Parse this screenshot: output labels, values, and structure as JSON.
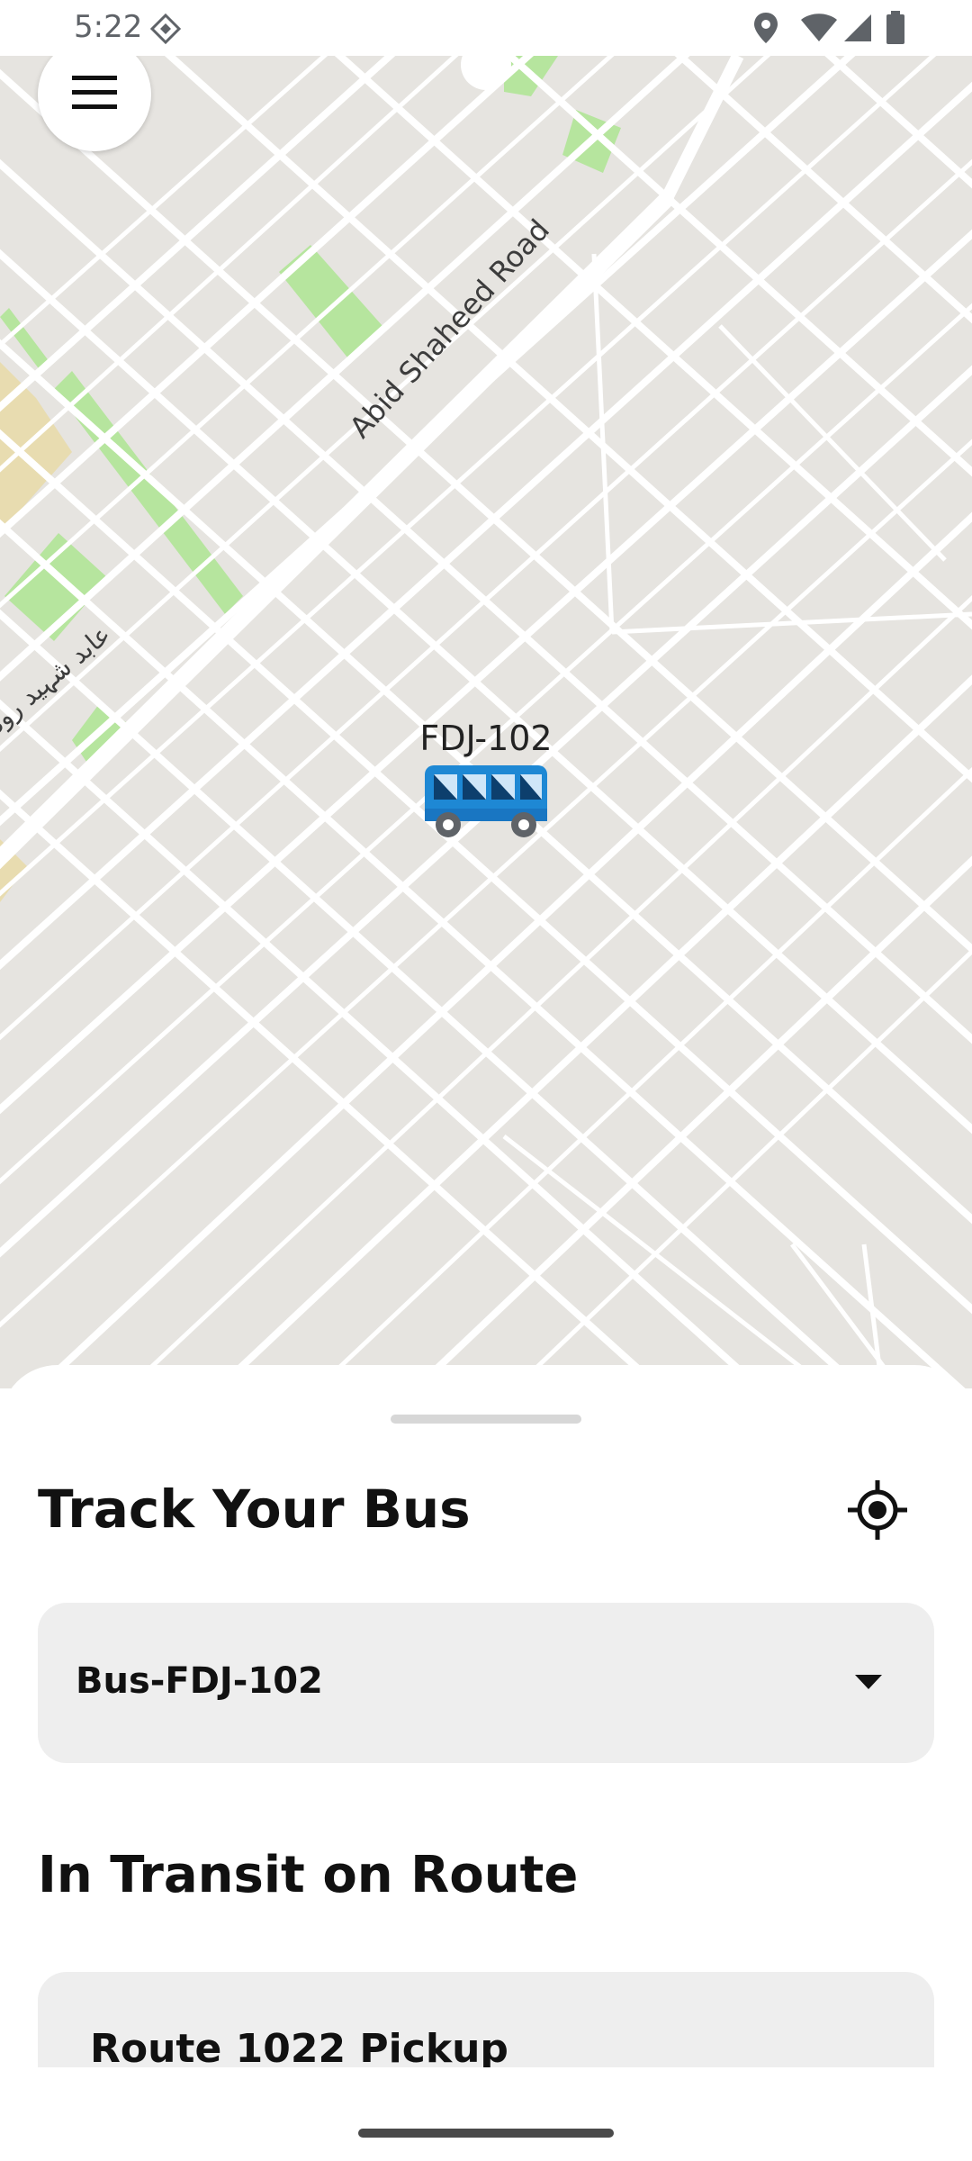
{
  "status_bar": {
    "time": "5:22",
    "icons": [
      "diamond-notification-icon",
      "location-icon",
      "wifi-icon",
      "signal-icon",
      "battery-icon"
    ]
  },
  "map": {
    "road_label": "Abid Shaheed Road",
    "urdu_road_label": "عابد شہید روڈ",
    "bus_marker_label": "FDJ-102",
    "colors": {
      "background": "#e6e4e0",
      "roads": "#ffffff",
      "parks": "#b6e59e",
      "sand": "#e8dcb0"
    }
  },
  "menu": {
    "icon": "hamburger-menu-icon"
  },
  "sheet": {
    "title": "Track Your Bus",
    "locate_icon": "my-location-icon",
    "bus_select": {
      "value": "Bus-FDJ-102"
    },
    "transit_heading": "In Transit on Route",
    "route_card": {
      "title": "Route 1022 Pickup"
    }
  },
  "colors": {
    "bus_blue": "#1e88d4",
    "sheet_field_bg": "#eeeeee"
  }
}
